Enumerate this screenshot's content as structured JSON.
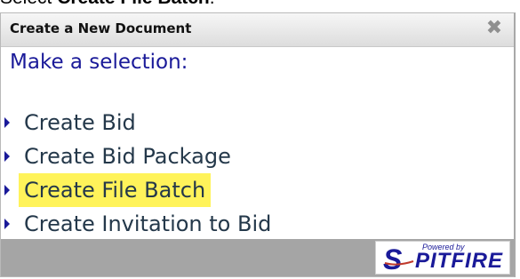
{
  "instruction": {
    "prefix": "Select ",
    "emphasis": "Create File Batch",
    "suffix": "."
  },
  "dialog": {
    "title": "Create a New Document",
    "close_glyph": "✖",
    "prompt": "Make a selection:",
    "options": [
      {
        "label": "Create Bid",
        "highlighted": false
      },
      {
        "label": "Create Bid Package",
        "highlighted": false
      },
      {
        "label": "Create File Batch",
        "highlighted": true
      },
      {
        "label": "Create Invitation to Bid",
        "highlighted": false
      }
    ],
    "footer": {
      "logo_powered_by": "Powered by",
      "logo_word": "PITFIRE",
      "logo_initial": "S"
    }
  },
  "colors": {
    "highlight": "#fff35a",
    "link": "#1a1a99",
    "footer": "#a5a5a5"
  }
}
